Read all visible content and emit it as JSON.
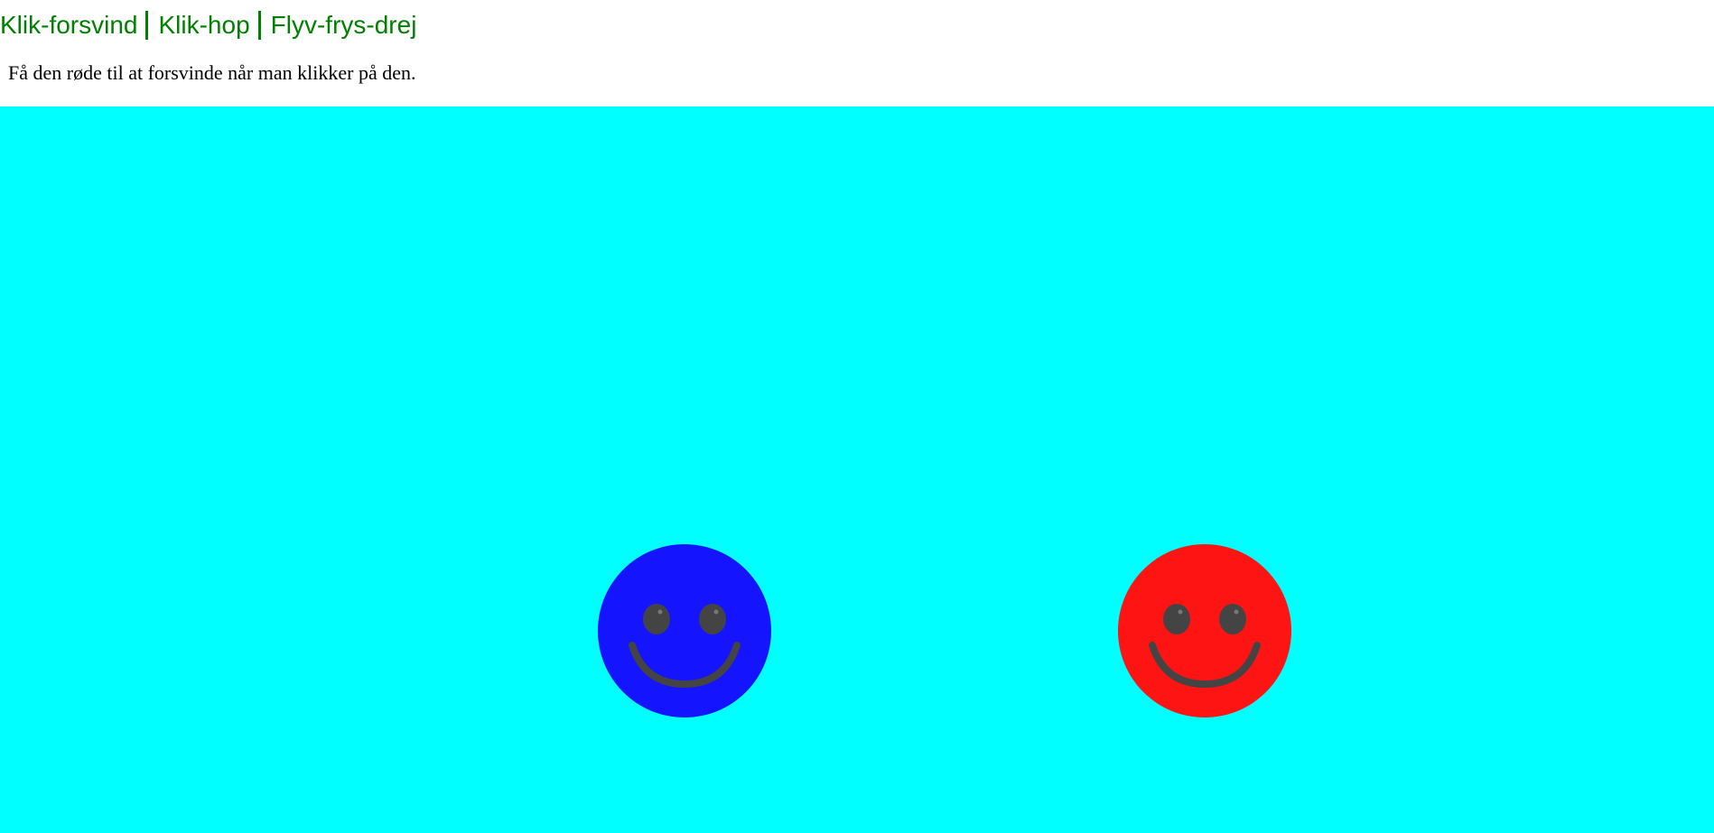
{
  "nav": {
    "links": [
      "Klik-forsvind",
      "Klik-hop",
      "Flyv-frys-drej"
    ],
    "color": "#008000"
  },
  "instruction": "Få den røde til at forsvinde når man klikker på den.",
  "stage": {
    "background": "#00ffff"
  },
  "smileys": [
    {
      "name": "blue smiley",
      "color": "#1414ff",
      "icon": "smiley-face-icon"
    },
    {
      "name": "red smiley",
      "color": "#ff1414",
      "icon": "smiley-face-icon"
    }
  ],
  "feature_color": "#444444"
}
